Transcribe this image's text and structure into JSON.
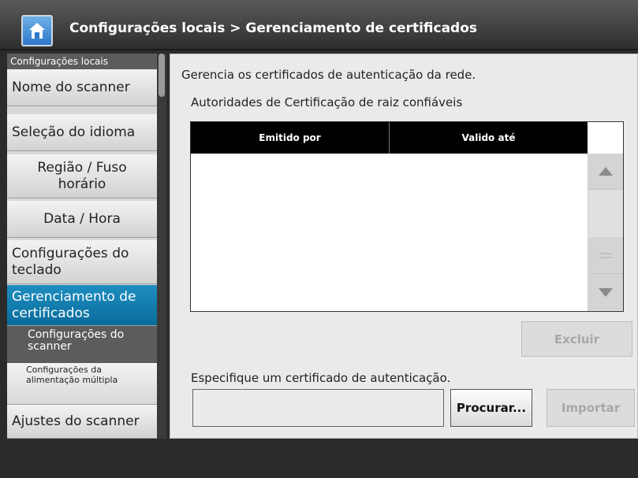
{
  "header": {
    "title": "Configurações locais > Gerenciamento de certificados",
    "home_icon": "home-icon"
  },
  "sidebar": {
    "section_local": "Configurações locais",
    "items": [
      {
        "label": "Nome do scanner"
      },
      {
        "label": "Seleção do idioma"
      },
      {
        "label": "Região / Fuso horário"
      },
      {
        "label": "Data / Hora"
      },
      {
        "label": "Configurações do teclado"
      },
      {
        "label": "Gerenciamento de certificados",
        "selected": true
      }
    ],
    "section_scanner": "Configurações do scanner",
    "sub_items": [
      {
        "label": "Configurações da alimentação múltipla"
      }
    ],
    "last_item": "Ajustes do scanner"
  },
  "main": {
    "description": "Gerencia os certificados de autenticação da rede.",
    "trusted_roots_label": "Autoridades de Certificação de raiz confiáveis",
    "table": {
      "columns": [
        "Emitido por",
        "Valido até"
      ],
      "rows": []
    },
    "delete_button": "Excluir",
    "specify_label": "Especifique um certificado de autenticação.",
    "file_input_value": "",
    "browse_button": "Procurar...",
    "import_button": "Importar"
  },
  "colors": {
    "selected_item": "#0a7aae",
    "header_bg": "#3a3a3a",
    "panel_bg": "#eaeaea"
  }
}
